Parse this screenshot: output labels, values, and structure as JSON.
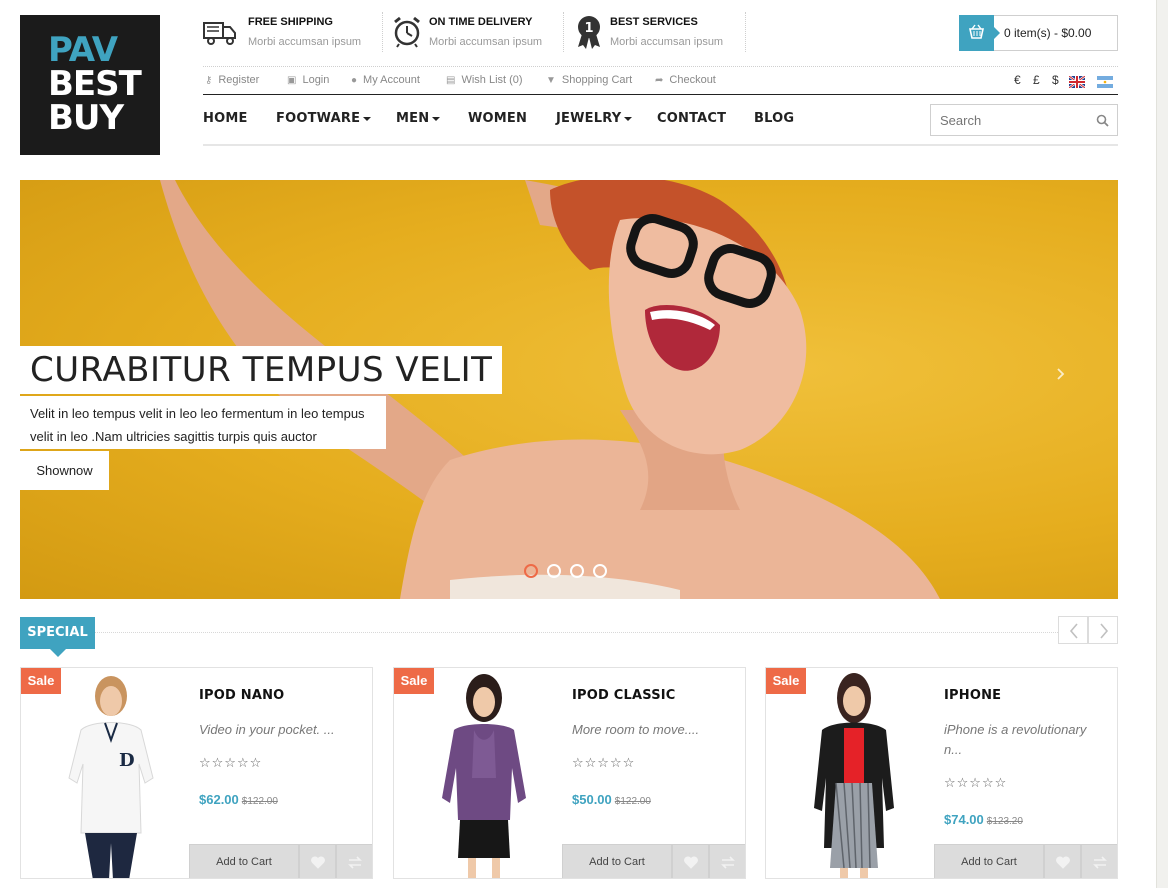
{
  "logo": {
    "line1": "PAV",
    "line2": "BEST",
    "line3": "BUY"
  },
  "features": [
    {
      "title": "FREE SHIPPING",
      "subtitle": "Morbi accumsan ipsum",
      "icon": "truck-icon"
    },
    {
      "title": "ON TIME DELIVERY",
      "subtitle": "Morbi accumsan ipsum",
      "icon": "alarm-clock-icon"
    },
    {
      "title": "BEST SERVICES",
      "subtitle": "Morbi accumsan ipsum",
      "icon": "award-ribbon-icon",
      "badge": "1"
    }
  ],
  "cart": {
    "label": "0 item(s) - $0.00",
    "icon": "basket-icon"
  },
  "top_links": [
    {
      "label": "Register",
      "icon": "key-icon"
    },
    {
      "label": "Login",
      "icon": "lock-icon"
    },
    {
      "label": "My Account",
      "icon": "user-icon"
    },
    {
      "label": "Wish List (0)",
      "icon": "list-icon"
    },
    {
      "label": "Shopping Cart",
      "icon": "cart-icon"
    },
    {
      "label": "Checkout",
      "icon": "share-arrow-icon"
    }
  ],
  "currencies": [
    "€",
    "£",
    "$"
  ],
  "languages": [
    "uk-flag-icon",
    "ar-flag-icon"
  ],
  "nav": [
    {
      "label": "HOME",
      "dropdown": false
    },
    {
      "label": "FOOTWARE",
      "dropdown": true
    },
    {
      "label": "MEN",
      "dropdown": true
    },
    {
      "label": "WOMEN",
      "dropdown": false
    },
    {
      "label": "JEWELRY",
      "dropdown": true
    },
    {
      "label": "CONTACT",
      "dropdown": false
    },
    {
      "label": "BLOG",
      "dropdown": false
    }
  ],
  "search": {
    "placeholder": "Search"
  },
  "hero": {
    "title": "CURABITUR TEMPUS VELIT",
    "description": "Velit in leo tempus velit in leo leo fermentum in leo tempus velit in leo .Nam ultricies sagittis turpis quis auctor",
    "button": "Shownow",
    "slides": 4,
    "active_slide": 1
  },
  "special": {
    "label": "SPECIAL"
  },
  "products": [
    {
      "sale": "Sale",
      "name": "IPOD NANO",
      "desc": "Video in your pocket. ...",
      "rating": "☆☆☆☆☆",
      "price": "$62.00",
      "old_price": "$122.00",
      "add_to_cart": "Add to Cart"
    },
    {
      "sale": "Sale",
      "name": "IPOD CLASSIC",
      "desc": "More room to move....",
      "rating": "☆☆☆☆☆",
      "price": "$50.00",
      "old_price": "$122.00",
      "add_to_cart": "Add to Cart"
    },
    {
      "sale": "Sale",
      "name": "IPHONE",
      "desc": "iPhone is a revolutionary n...",
      "rating": "☆☆☆☆☆",
      "price": "$74.00",
      "old_price": "$123.20",
      "add_to_cart": "Add to Cart"
    }
  ],
  "colors": {
    "accent": "#3fa3c0",
    "sale": "#ee6a47",
    "hero_bg": "#e5ad1e",
    "logo_bg": "#1b1b1b"
  }
}
